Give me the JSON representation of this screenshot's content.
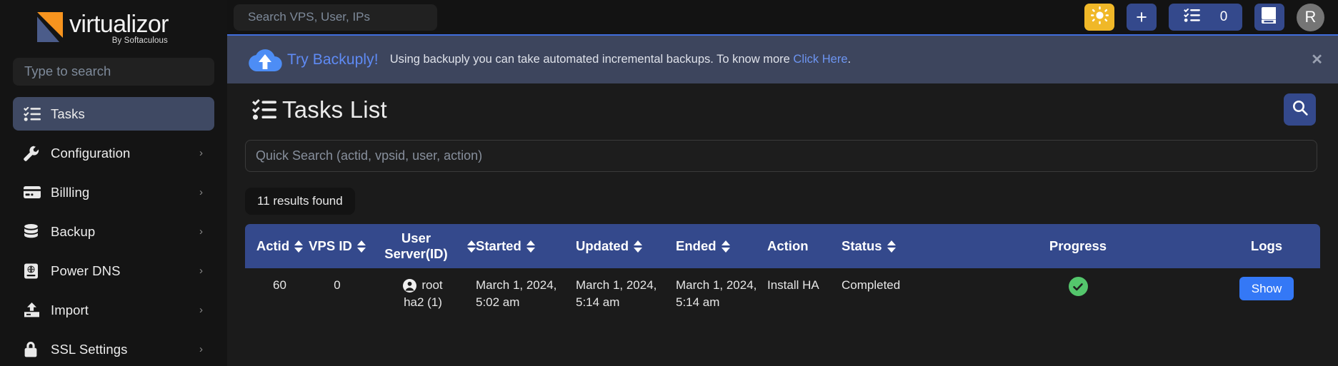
{
  "brand": {
    "name": "virtualizor",
    "tagline": "By Softaculous"
  },
  "sidebar": {
    "search_placeholder": "Type to search",
    "items": [
      {
        "label": "Tasks",
        "icon": "checklist-icon",
        "active": true,
        "chevron": ""
      },
      {
        "label": "Configuration",
        "icon": "wrench-icon",
        "active": false,
        "chevron": "›"
      },
      {
        "label": "Billling",
        "icon": "credit-card-icon",
        "active": false,
        "chevron": "›"
      },
      {
        "label": "Backup",
        "icon": "database-icon",
        "active": false,
        "chevron": "›"
      },
      {
        "label": "Power DNS",
        "icon": "globe-card-icon",
        "active": false,
        "chevron": "›"
      },
      {
        "label": "Import",
        "icon": "upload-icon",
        "active": false,
        "chevron": "›"
      },
      {
        "label": "SSL Settings",
        "icon": "lock-icon",
        "active": false,
        "chevron": "›"
      }
    ]
  },
  "topbar": {
    "search_placeholder": "Search VPS, User, IPs",
    "theme_icon": "sun-icon",
    "add_label": "+",
    "tasks_icon": "checklist-icon",
    "tasks_count": "0",
    "docs_icon": "book-icon",
    "avatar_initial": "R"
  },
  "banner": {
    "icon": "cloud-upload-icon",
    "title": "Try Backuply!",
    "text_before": "Using backuply you can take automated incremental backups. To know more",
    "link": "Click Here",
    "text_after": ".",
    "close_icon": "close-icon"
  },
  "page": {
    "icon": "checklist-icon",
    "title": "Tasks List",
    "search_button_icon": "search-icon",
    "quick_search_placeholder": "Quick Search (actid, vpsid, user, action)",
    "results_found": "11 results found"
  },
  "table": {
    "columns": [
      {
        "label": "Actid",
        "sortable": true
      },
      {
        "label": "VPS ID",
        "sortable": true
      },
      {
        "label": "User Server(ID)",
        "sortable": true
      },
      {
        "label": "Started",
        "sortable": true
      },
      {
        "label": "Updated",
        "sortable": true
      },
      {
        "label": "Ended",
        "sortable": true
      },
      {
        "label": "Action",
        "sortable": false
      },
      {
        "label": "Status",
        "sortable": true
      },
      {
        "label": "Progress",
        "sortable": false
      },
      {
        "label": "Logs",
        "sortable": false
      }
    ],
    "rows": [
      {
        "actid": "60",
        "vpsid": "0",
        "user": "root",
        "server": "ha2 (1)",
        "started_date": "March 1, 2024,",
        "started_time": "5:02 am",
        "updated_date": "March 1, 2024,",
        "updated_time": "5:14 am",
        "ended_date": "March 1, 2024,",
        "ended_time": "5:14 am",
        "action": "Install HA",
        "status": "Completed",
        "progress_icon": "check-circle-icon",
        "logs_label": "Show"
      }
    ]
  },
  "colors": {
    "accent_blue": "#34498c",
    "link_blue": "#6d95f2",
    "button_blue": "#3478f6",
    "success_green": "#54c66c",
    "theme_yellow": "#f0b828",
    "banner_bg": "#3d455d"
  }
}
